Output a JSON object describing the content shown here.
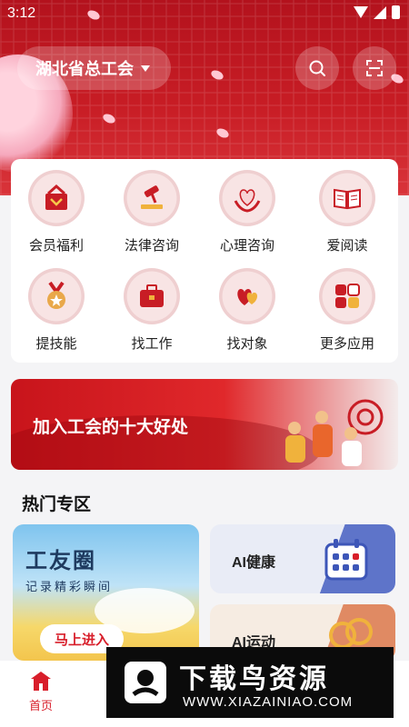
{
  "status_bar": {
    "time": "3:12"
  },
  "header": {
    "location_label": "湖北省总工会"
  },
  "grid": [
    {
      "label": "会员福利",
      "icon": "gift-box-icon"
    },
    {
      "label": "法律咨询",
      "icon": "gavel-icon"
    },
    {
      "label": "心理咨询",
      "icon": "heart-hands-icon"
    },
    {
      "label": "爱阅读",
      "icon": "open-book-icon"
    },
    {
      "label": "提技能",
      "icon": "medal-icon"
    },
    {
      "label": "找工作",
      "icon": "briefcase-icon"
    },
    {
      "label": "找对象",
      "icon": "hearts-icon"
    },
    {
      "label": "更多应用",
      "icon": "apps-grid-icon"
    }
  ],
  "banner": {
    "title": "加入工会的十大好处"
  },
  "hot_zone": {
    "title": "热门专区",
    "main_card": {
      "title": "工友圈",
      "subtitle": "记录精彩瞬间",
      "button": "马上进入"
    },
    "side_cards": [
      {
        "title": "AI健康",
        "color": "#e9ecf6"
      },
      {
        "title": "AI运动",
        "color": "#f6ece2"
      }
    ]
  },
  "bottom_nav": {
    "home_label": "首页"
  },
  "watermark": {
    "title": "下载鸟资源",
    "url": "WWW.XIAZAINIAO.COM"
  },
  "colors": {
    "brand_red": "#c81d25",
    "accent_red": "#d81e2a"
  }
}
